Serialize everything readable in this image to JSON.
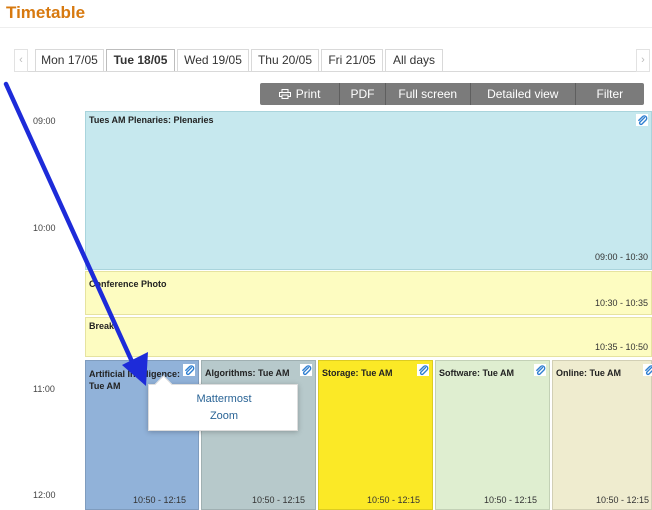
{
  "page_title": "Timetable",
  "days": {
    "tabs": [
      {
        "label": "Mon 17/05",
        "active": false
      },
      {
        "label": "Tue 18/05",
        "active": true
      },
      {
        "label": "Wed 19/05",
        "active": false
      },
      {
        "label": "Thu 20/05",
        "active": false
      },
      {
        "label": "Fri 21/05",
        "active": false
      },
      {
        "label": "All days",
        "active": false
      }
    ],
    "prev_icon": "chevron-left-icon",
    "next_icon": "chevron-right-icon"
  },
  "toolbar": {
    "print_label": "Print",
    "print_icon": "printer-icon",
    "pdf_label": "PDF",
    "fullscreen_label": "Full screen",
    "detailed_label": "Detailed view",
    "filter_label": "Filter"
  },
  "timeline": {
    "hours": [
      "09:00",
      "10:00",
      "11:00",
      "12:00"
    ]
  },
  "sessions": {
    "plenaries": {
      "title": "Tues AM Plenaries: Plenaries",
      "time": "09:00 - 10:30",
      "color": "#c6e8ee"
    },
    "photo": {
      "title": "Conference Photo",
      "time": "10:30 - 10:35",
      "color": "#fdfcc1"
    },
    "break": {
      "title": "Break",
      "time": "10:35 - 10:50",
      "color": "#fdfcc1"
    }
  },
  "tracks": [
    {
      "title": "Artificial Intelligence: Tue AM",
      "line1": "Artificial Intelligence:",
      "line2": "Tue AM",
      "time": "10:50 - 12:15",
      "color": "#91b2d9"
    },
    {
      "title": "Algorithms: Tue AM",
      "time": "10:50 - 12:15",
      "color": "#b7c9cb"
    },
    {
      "title": "Storage: Tue AM",
      "time": "10:50 - 12:15",
      "color": "#fbe926"
    },
    {
      "title": "Software: Tue AM",
      "time": "10:50 - 12:15",
      "color": "#dfeed0"
    },
    {
      "title": "Online: Tue AM",
      "time": "10:50 - 12:15",
      "color": "#efeccf"
    }
  ],
  "popup": {
    "items": [
      "Mattermost",
      "Zoom"
    ]
  },
  "colors": {
    "accent": "#d7790f",
    "toolbar": "#7b7b7b",
    "link": "#2a6496",
    "attachment_icon": "#2f7fd1",
    "annotation_arrow": "#1d2bd9"
  },
  "icons": {
    "attachment": "paperclip-icon",
    "annotation": "arrow-annotation"
  }
}
